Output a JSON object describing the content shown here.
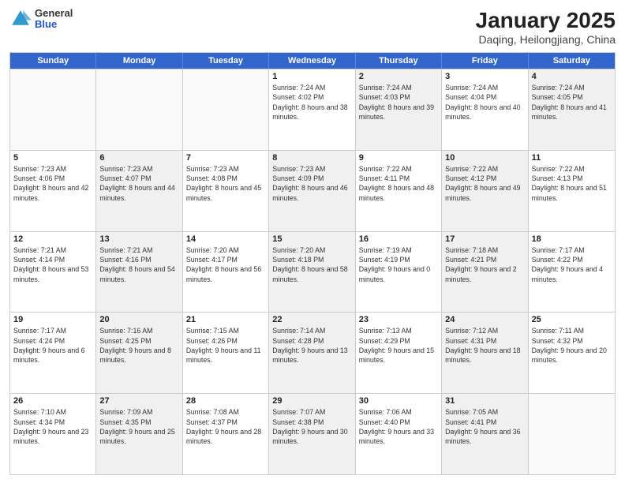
{
  "header": {
    "logo": {
      "general": "General",
      "blue": "Blue"
    },
    "title": "January 2025",
    "subtitle": "Daqing, Heilongjiang, China"
  },
  "weekdays": [
    "Sunday",
    "Monday",
    "Tuesday",
    "Wednesday",
    "Thursday",
    "Friday",
    "Saturday"
  ],
  "rows": [
    [
      {
        "day": "",
        "sunrise": "",
        "sunset": "",
        "daylight": "",
        "shaded": false,
        "empty": true
      },
      {
        "day": "",
        "sunrise": "",
        "sunset": "",
        "daylight": "",
        "shaded": false,
        "empty": true
      },
      {
        "day": "",
        "sunrise": "",
        "sunset": "",
        "daylight": "",
        "shaded": false,
        "empty": true
      },
      {
        "day": "1",
        "sunrise": "Sunrise: 7:24 AM",
        "sunset": "Sunset: 4:02 PM",
        "daylight": "Daylight: 8 hours and 38 minutes.",
        "shaded": false,
        "empty": false
      },
      {
        "day": "2",
        "sunrise": "Sunrise: 7:24 AM",
        "sunset": "Sunset: 4:03 PM",
        "daylight": "Daylight: 8 hours and 39 minutes.",
        "shaded": true,
        "empty": false
      },
      {
        "day": "3",
        "sunrise": "Sunrise: 7:24 AM",
        "sunset": "Sunset: 4:04 PM",
        "daylight": "Daylight: 8 hours and 40 minutes.",
        "shaded": false,
        "empty": false
      },
      {
        "day": "4",
        "sunrise": "Sunrise: 7:24 AM",
        "sunset": "Sunset: 4:05 PM",
        "daylight": "Daylight: 8 hours and 41 minutes.",
        "shaded": true,
        "empty": false
      }
    ],
    [
      {
        "day": "5",
        "sunrise": "Sunrise: 7:23 AM",
        "sunset": "Sunset: 4:06 PM",
        "daylight": "Daylight: 8 hours and 42 minutes.",
        "shaded": false,
        "empty": false
      },
      {
        "day": "6",
        "sunrise": "Sunrise: 7:23 AM",
        "sunset": "Sunset: 4:07 PM",
        "daylight": "Daylight: 8 hours and 44 minutes.",
        "shaded": true,
        "empty": false
      },
      {
        "day": "7",
        "sunrise": "Sunrise: 7:23 AM",
        "sunset": "Sunset: 4:08 PM",
        "daylight": "Daylight: 8 hours and 45 minutes.",
        "shaded": false,
        "empty": false
      },
      {
        "day": "8",
        "sunrise": "Sunrise: 7:23 AM",
        "sunset": "Sunset: 4:09 PM",
        "daylight": "Daylight: 8 hours and 46 minutes.",
        "shaded": true,
        "empty": false
      },
      {
        "day": "9",
        "sunrise": "Sunrise: 7:22 AM",
        "sunset": "Sunset: 4:11 PM",
        "daylight": "Daylight: 8 hours and 48 minutes.",
        "shaded": false,
        "empty": false
      },
      {
        "day": "10",
        "sunrise": "Sunrise: 7:22 AM",
        "sunset": "Sunset: 4:12 PM",
        "daylight": "Daylight: 8 hours and 49 minutes.",
        "shaded": true,
        "empty": false
      },
      {
        "day": "11",
        "sunrise": "Sunrise: 7:22 AM",
        "sunset": "Sunset: 4:13 PM",
        "daylight": "Daylight: 8 hours and 51 minutes.",
        "shaded": false,
        "empty": false
      }
    ],
    [
      {
        "day": "12",
        "sunrise": "Sunrise: 7:21 AM",
        "sunset": "Sunset: 4:14 PM",
        "daylight": "Daylight: 8 hours and 53 minutes.",
        "shaded": false,
        "empty": false
      },
      {
        "day": "13",
        "sunrise": "Sunrise: 7:21 AM",
        "sunset": "Sunset: 4:16 PM",
        "daylight": "Daylight: 8 hours and 54 minutes.",
        "shaded": true,
        "empty": false
      },
      {
        "day": "14",
        "sunrise": "Sunrise: 7:20 AM",
        "sunset": "Sunset: 4:17 PM",
        "daylight": "Daylight: 8 hours and 56 minutes.",
        "shaded": false,
        "empty": false
      },
      {
        "day": "15",
        "sunrise": "Sunrise: 7:20 AM",
        "sunset": "Sunset: 4:18 PM",
        "daylight": "Daylight: 8 hours and 58 minutes.",
        "shaded": true,
        "empty": false
      },
      {
        "day": "16",
        "sunrise": "Sunrise: 7:19 AM",
        "sunset": "Sunset: 4:19 PM",
        "daylight": "Daylight: 9 hours and 0 minutes.",
        "shaded": false,
        "empty": false
      },
      {
        "day": "17",
        "sunrise": "Sunrise: 7:18 AM",
        "sunset": "Sunset: 4:21 PM",
        "daylight": "Daylight: 9 hours and 2 minutes.",
        "shaded": true,
        "empty": false
      },
      {
        "day": "18",
        "sunrise": "Sunrise: 7:17 AM",
        "sunset": "Sunset: 4:22 PM",
        "daylight": "Daylight: 9 hours and 4 minutes.",
        "shaded": false,
        "empty": false
      }
    ],
    [
      {
        "day": "19",
        "sunrise": "Sunrise: 7:17 AM",
        "sunset": "Sunset: 4:24 PM",
        "daylight": "Daylight: 9 hours and 6 minutes.",
        "shaded": false,
        "empty": false
      },
      {
        "day": "20",
        "sunrise": "Sunrise: 7:16 AM",
        "sunset": "Sunset: 4:25 PM",
        "daylight": "Daylight: 9 hours and 8 minutes.",
        "shaded": true,
        "empty": false
      },
      {
        "day": "21",
        "sunrise": "Sunrise: 7:15 AM",
        "sunset": "Sunset: 4:26 PM",
        "daylight": "Daylight: 9 hours and 11 minutes.",
        "shaded": false,
        "empty": false
      },
      {
        "day": "22",
        "sunrise": "Sunrise: 7:14 AM",
        "sunset": "Sunset: 4:28 PM",
        "daylight": "Daylight: 9 hours and 13 minutes.",
        "shaded": true,
        "empty": false
      },
      {
        "day": "23",
        "sunrise": "Sunrise: 7:13 AM",
        "sunset": "Sunset: 4:29 PM",
        "daylight": "Daylight: 9 hours and 15 minutes.",
        "shaded": false,
        "empty": false
      },
      {
        "day": "24",
        "sunrise": "Sunrise: 7:12 AM",
        "sunset": "Sunset: 4:31 PM",
        "daylight": "Daylight: 9 hours and 18 minutes.",
        "shaded": true,
        "empty": false
      },
      {
        "day": "25",
        "sunrise": "Sunrise: 7:11 AM",
        "sunset": "Sunset: 4:32 PM",
        "daylight": "Daylight: 9 hours and 20 minutes.",
        "shaded": false,
        "empty": false
      }
    ],
    [
      {
        "day": "26",
        "sunrise": "Sunrise: 7:10 AM",
        "sunset": "Sunset: 4:34 PM",
        "daylight": "Daylight: 9 hours and 23 minutes.",
        "shaded": false,
        "empty": false
      },
      {
        "day": "27",
        "sunrise": "Sunrise: 7:09 AM",
        "sunset": "Sunset: 4:35 PM",
        "daylight": "Daylight: 9 hours and 25 minutes.",
        "shaded": true,
        "empty": false
      },
      {
        "day": "28",
        "sunrise": "Sunrise: 7:08 AM",
        "sunset": "Sunset: 4:37 PM",
        "daylight": "Daylight: 9 hours and 28 minutes.",
        "shaded": false,
        "empty": false
      },
      {
        "day": "29",
        "sunrise": "Sunrise: 7:07 AM",
        "sunset": "Sunset: 4:38 PM",
        "daylight": "Daylight: 9 hours and 30 minutes.",
        "shaded": true,
        "empty": false
      },
      {
        "day": "30",
        "sunrise": "Sunrise: 7:06 AM",
        "sunset": "Sunset: 4:40 PM",
        "daylight": "Daylight: 9 hours and 33 minutes.",
        "shaded": false,
        "empty": false
      },
      {
        "day": "31",
        "sunrise": "Sunrise: 7:05 AM",
        "sunset": "Sunset: 4:41 PM",
        "daylight": "Daylight: 9 hours and 36 minutes.",
        "shaded": true,
        "empty": false
      },
      {
        "day": "",
        "sunrise": "",
        "sunset": "",
        "daylight": "",
        "shaded": false,
        "empty": true
      }
    ]
  ]
}
